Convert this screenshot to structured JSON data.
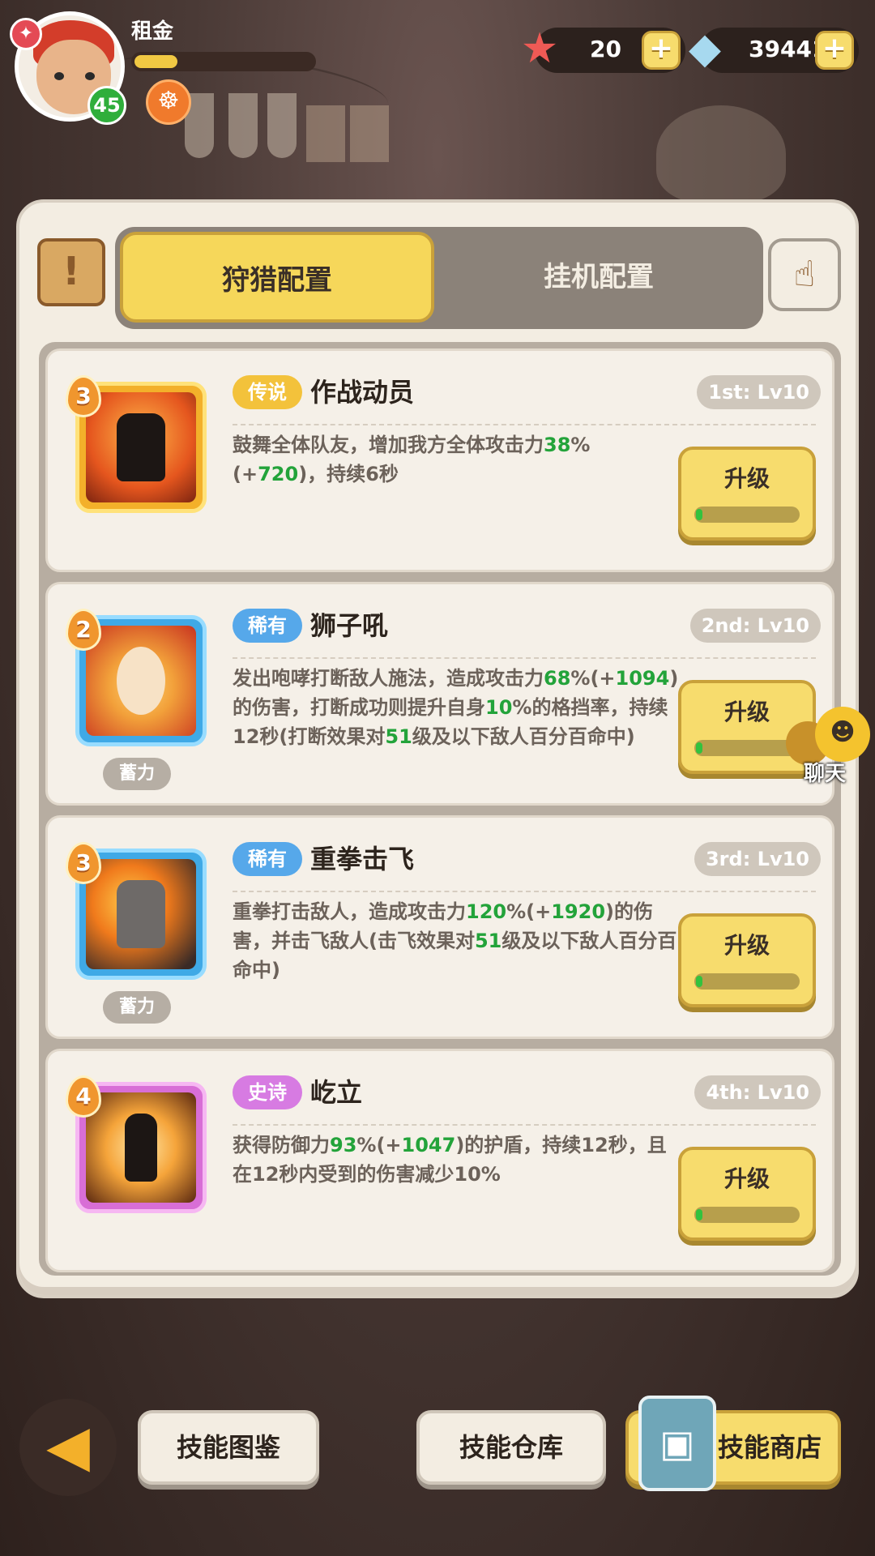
{
  "player": {
    "name": "租金",
    "level": "45",
    "xp_fraction": 0.24
  },
  "currencies": [
    {
      "icon": "starfish-icon",
      "value": "20"
    },
    {
      "icon": "shell-gem-icon",
      "value": "39441"
    }
  ],
  "tabs": {
    "hunt": "狩猎配置",
    "idle": "挂机配置",
    "active": "hunt"
  },
  "skills": [
    {
      "rank": "3",
      "rarity": "传说",
      "name": "作战动员",
      "slot": "1st: Lv10",
      "charge": "",
      "desc_parts": [
        "鼓舞全体队友，增加我方全体攻击力",
        "38",
        "%(+",
        "720",
        ")，持续6秒"
      ],
      "upgrade_label": "升级"
    },
    {
      "rank": "2",
      "rarity": "稀有",
      "name": "狮子吼",
      "slot": "2nd: Lv10",
      "charge": "蓄力",
      "desc_parts": [
        "发出咆哮打断敌人施法，造成攻击力",
        "68",
        "%(+",
        "1094",
        ")的伤害，打断成功则提升自身",
        "10",
        "%的格挡率，持续12秒(打断效果对",
        "51",
        "级及以下敌人百分百命中)"
      ],
      "upgrade_label": "升级"
    },
    {
      "rank": "3",
      "rarity": "稀有",
      "name": "重拳击飞",
      "slot": "3rd: Lv10",
      "charge": "蓄力",
      "desc_parts": [
        "重拳打击敌人，造成攻击力",
        "120",
        "%(+",
        "1920",
        ")的伤害，并击飞敌人(击飞效果对",
        "51",
        "级及以下敌人百分百命中)"
      ],
      "upgrade_label": "升级"
    },
    {
      "rank": "4",
      "rarity": "史诗",
      "name": "屹立",
      "slot": "4th: Lv10",
      "charge": "",
      "desc_parts": [
        "获得防御力",
        "93",
        "%(+",
        "1047",
        ")的护盾，持续12秒，且在12秒内受到的伤害减少10%"
      ],
      "upgrade_label": "升级"
    }
  ],
  "chat": {
    "label": "聊天"
  },
  "bottom": {
    "codex": "技能图鉴",
    "storage": "技能仓库",
    "shop": "技能商店"
  }
}
